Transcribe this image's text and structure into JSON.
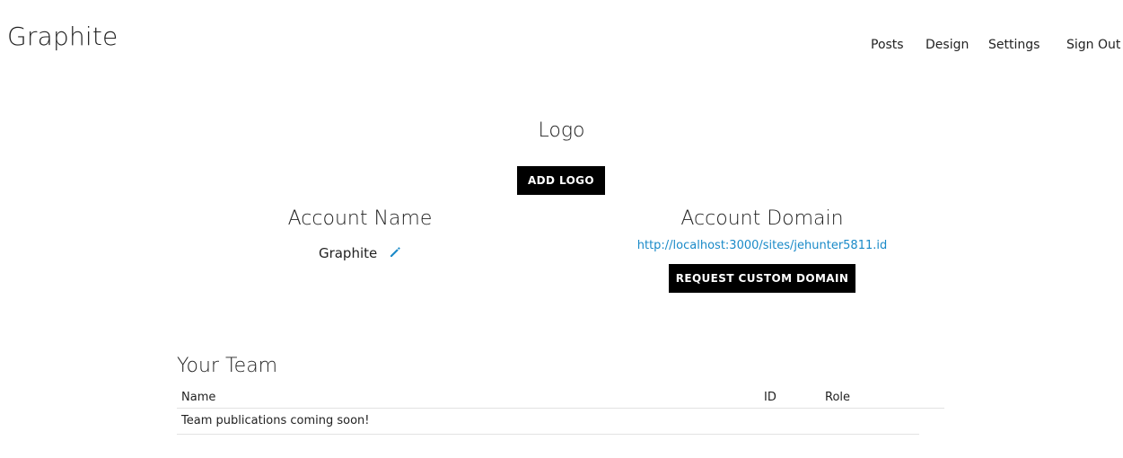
{
  "header": {
    "brand": "Graphite",
    "nav": {
      "posts": "Posts",
      "design": "Design",
      "settings": "Settings",
      "sign_out": "Sign Out"
    }
  },
  "logo_section": {
    "title": "Logo",
    "add_logo_label": "ADD LOGO"
  },
  "account_name": {
    "title": "Account Name",
    "value": "Graphite",
    "edit_icon": "pencil-icon"
  },
  "account_domain": {
    "title": "Account Domain",
    "url": "http://localhost:3000/sites/jehunter5811.id",
    "request_label": "REQUEST CUSTOM DOMAIN"
  },
  "team": {
    "title": "Your Team",
    "columns": [
      "Name",
      "ID",
      "Role"
    ],
    "empty_message": "Team publications coming soon!"
  },
  "colors": {
    "link": "#1a8ac8",
    "button_bg": "#000000",
    "button_text": "#ffffff",
    "divider": "#e2e2e2"
  }
}
